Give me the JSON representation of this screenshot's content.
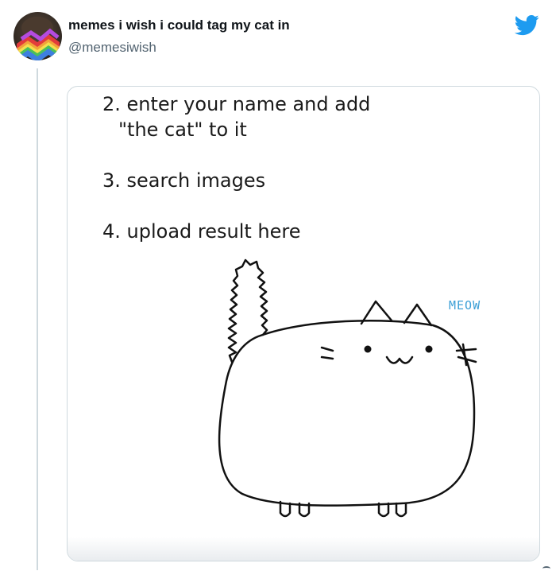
{
  "tweet": {
    "display_name": "memes i wish i could tag my cat in",
    "handle": "@memesiwish"
  },
  "media": {
    "steps": [
      {
        "line1": "2. enter your name and add",
        "line2": "\"the cat\" to it"
      },
      {
        "line1": "3. search images"
      },
      {
        "line1": "4. upload result here"
      }
    ],
    "cat_caption": "MEOW"
  },
  "colors": {
    "brand": "#1d9bf0",
    "meow_text": "#3b9fd6"
  }
}
